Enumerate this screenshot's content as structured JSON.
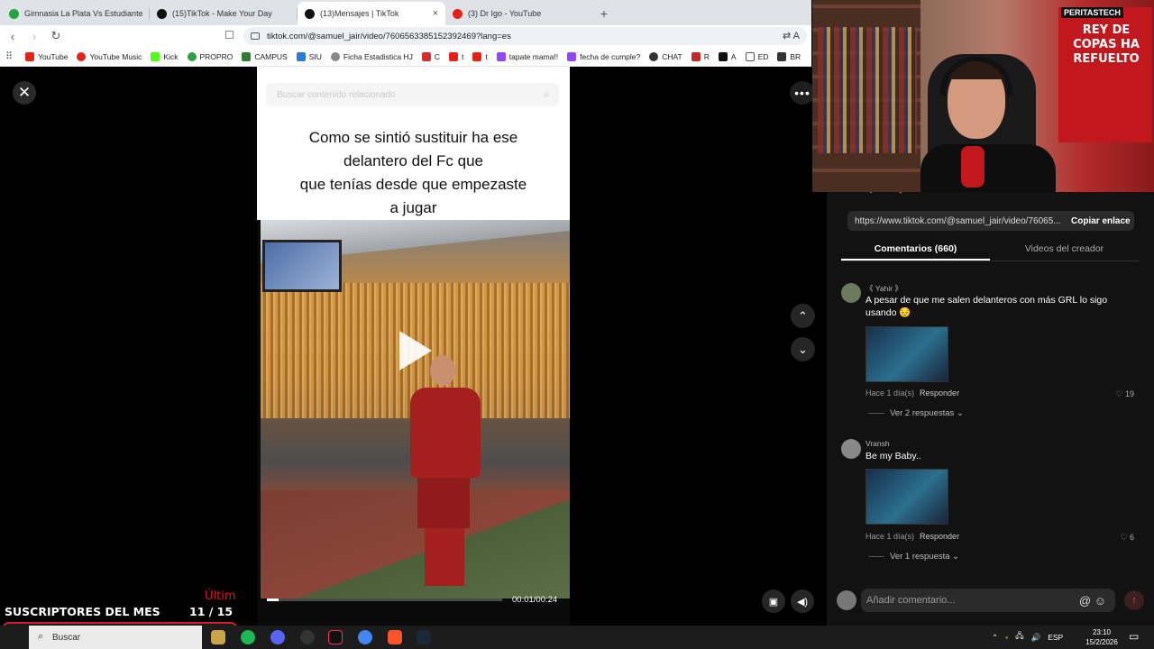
{
  "browser": {
    "tabs": [
      {
        "title": "Gimnasia La Plata Vs Estudiantes de",
        "favicon_color": "#25a244",
        "active": false
      },
      {
        "title": "(15)TikTok - Make Your Day",
        "favicon_color": "#111111",
        "active": false
      },
      {
        "title": "(13)Mensajes | TikTok",
        "favicon_color": "#111111",
        "active": true
      },
      {
        "title": "(3) Dr Igo - YouTube",
        "favicon_color": "#e62117",
        "active": false
      }
    ],
    "new_tab": "+",
    "tab_close": "×",
    "url": "tiktok.com/@samuel_jair/video/7606563385152392469?lang=es",
    "bookmarks": [
      {
        "label": "YouTube",
        "color": "#e62117"
      },
      {
        "label": "YouTube Music",
        "color": "#e62117"
      },
      {
        "label": "Kick",
        "color": "#53fc18"
      },
      {
        "label": "PROPRO",
        "color": "#2ea043"
      },
      {
        "label": "CAMPUS",
        "color": "#2e7d32"
      },
      {
        "label": "SIU",
        "color": "#2b7bd9"
      },
      {
        "label": "Ficha Estadistica HJ",
        "color": "#888888"
      },
      {
        "label": "C",
        "color": "#d32f2f"
      },
      {
        "label": "t",
        "color": "#e62117"
      },
      {
        "label": "t",
        "color": "#e62117"
      },
      {
        "label": "tapate mama!!",
        "color": "#9146ff"
      },
      {
        "label": "fecha de cumple?",
        "color": "#9146ff"
      },
      {
        "label": "CHAT",
        "color": "#333333"
      },
      {
        "label": "R",
        "color": "#c62828"
      },
      {
        "label": "A",
        "color": "#111111"
      },
      {
        "label": "ED",
        "color": "#555555"
      },
      {
        "label": "BR",
        "color": "#333333"
      }
    ]
  },
  "video": {
    "search_placeholder": "Buscar contenido relacionado",
    "caption_lines": [
      "Como se sintió sustituir ha  ese",
      "delantero del Fc que",
      "que tenías desde que empezaste",
      "a jugar"
    ],
    "time": "00:01/00:24",
    "progress_fraction": 0.05
  },
  "panel": {
    "url": "https://www.tiktok.com/@samuel_jair/video/76065...",
    "copy_label": "Copiar enlace",
    "tabs": [
      "Comentarios (660)",
      "Videos del creador"
    ],
    "comments": [
      {
        "user": "《 Yahir 》",
        "text": "A pesar de que me salen delanteros con más GRL lo sigo usando 😔",
        "time": "Hace 1 día(s)",
        "reply": "Responder",
        "likes": "19",
        "replies": "Ver 2 respuestas"
      },
      {
        "user": "Vransh",
        "text": "Be my Baby..",
        "time": "Hace 1 día(s)",
        "reply": "Responder",
        "likes": "6",
        "replies": "Ver 1 respuesta"
      }
    ],
    "add_comment_placeholder": "Añadir comentario..."
  },
  "webcam": {
    "flag_top": "PERITASTECH",
    "flag_text": "REY DE COPAS HA REFUELTO"
  },
  "overlay": {
    "subs_label": "SUSCRIPTORES DEL MES",
    "subs_count": "11  / 15",
    "subs_fraction": 0.73,
    "ultim": "Últim"
  },
  "taskbar": {
    "search_label": "Buscar",
    "lang": "ESP",
    "time": "23:10",
    "date": "15/2/2026"
  }
}
